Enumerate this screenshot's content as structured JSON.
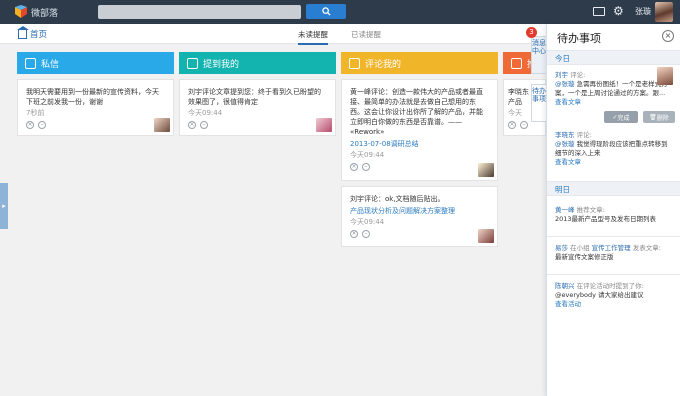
{
  "topbar": {
    "brand": "微部落",
    "username": "张璇"
  },
  "subbar": {
    "home": "首页",
    "tab_unread": "未读提醒",
    "tab_read": "已读提醒"
  },
  "columns": {
    "private": "私信",
    "mention": "提到我的",
    "comment": "评论我的",
    "other": "推"
  },
  "cards": {
    "private1": {
      "text": "我明天需要用到一份最新的宣传资料，今天下班之前发我一份，谢谢",
      "time": "7秒前"
    },
    "mention1": {
      "text": "刘宇评论文章提到您：终于看到久已盼望的效果图了，很值得肯定",
      "time": "今天09:44"
    },
    "comment1": {
      "text": "黄一峰评论：创造一款伟大的产品或者最直接、最简单的办法就是去做自己想用的东西。这会让你设计出你所了解的产品，并能立即明白你做的东西是否靠谱。—— «Rework»",
      "link": "2013-07-08调研总结",
      "time": "今天09:44"
    },
    "comment2": {
      "text": "刘宇评论：ok,文档随后贴出。",
      "link": "产品现状分析及问题解决方案整理",
      "time": "今天09:44"
    },
    "other1": {
      "text": "李晓东",
      "text2": "产品",
      "time": "今天"
    }
  },
  "panel": {
    "title": "待办事项",
    "today": "今日",
    "tomorrow": "明日",
    "side_tab_1": "消息中心",
    "side_tab_2": "待办事项",
    "badge": "3",
    "item1": {
      "author": "刘宇",
      "meta": "评论:",
      "at": "@张璇",
      "text": "急需再份图纸！一个是老样式方案，一个是上周讨论通过的方案。跟...",
      "link": "查看文章",
      "done": "完成",
      "delete": "删除"
    },
    "item2": {
      "author": "李晓东",
      "meta": "评论:",
      "at": "@张璇",
      "text": "我觉得现阶段应该把重点转移到细节的深入上来",
      "link": "查看文章"
    },
    "item3": {
      "author": "黄一峰",
      "meta": "推荐文章:",
      "text": "2013最新产品型号及发布日期列表"
    },
    "item4": {
      "author": "易莎",
      "meta1": "在小组",
      "group": "宣传工作管理",
      "meta2": "发表文章:",
      "text": "最新宣传文案修正版"
    },
    "item5": {
      "author": "陈朝兴",
      "meta": "在评论活动时提到了你:",
      "text": "@everybody 请大家给出建议",
      "link": "查看活动"
    }
  }
}
